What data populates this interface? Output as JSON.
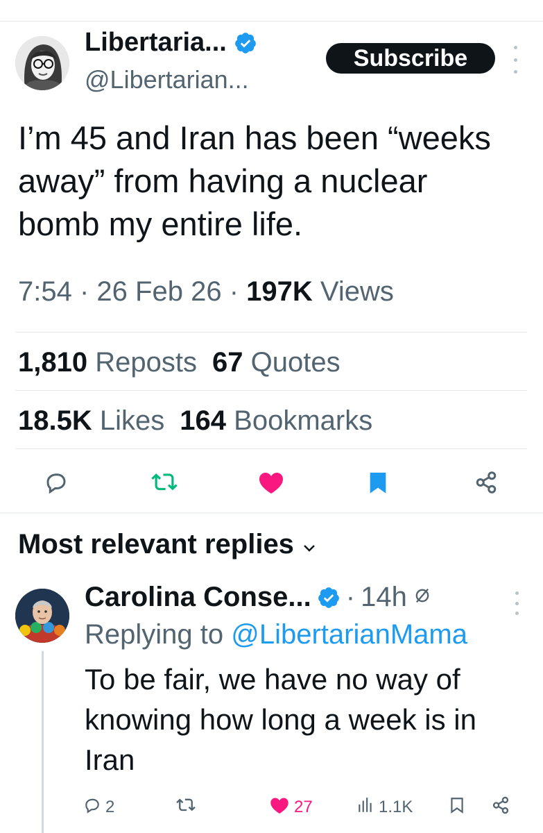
{
  "tweet": {
    "author_name": "Libertaria...",
    "author_handle": "@Libertarian...",
    "subscribe_label": "Subscribe",
    "text": "I’m 45 and Iran has been “weeks away” from having a nuclear bomb my entire life.",
    "time": "7:54",
    "date": "26 Feb 26",
    "views_count": "197K",
    "views_label": "Views",
    "reposts_count": "1,810",
    "reposts_label": "Reposts",
    "quotes_count": "67",
    "quotes_label": "Quotes",
    "likes_count": "18.5K",
    "likes_label": "Likes",
    "bookmarks_count": "164",
    "bookmarks_label": "Bookmarks"
  },
  "replies_section": {
    "title": "Most relevant replies"
  },
  "reply": {
    "author_name": "Carolina Conse...",
    "time": "14h",
    "replying_prefix": "Replying to",
    "replying_handle": "@LibertarianMama",
    "text": "To be fair, we have no way of knowing how long a week is in Iran",
    "reply_count": "2",
    "like_count": "27",
    "view_count": "1.1K"
  },
  "colors": {
    "verified": "#1d9bf0",
    "repost": "#00ba7c",
    "like": "#f91880",
    "bookmark": "#1d9bf0",
    "secondary_text": "#536471"
  },
  "icons": {
    "verified": "verified-badge-icon",
    "reply": "reply-bubble-icon",
    "repost": "repost-arrows-icon",
    "like": "heart-icon",
    "bookmark": "bookmark-icon",
    "share": "share-icon",
    "views": "bar-chart-icon",
    "mute": "slashed-circle-icon",
    "more": "more-dots-icon"
  }
}
